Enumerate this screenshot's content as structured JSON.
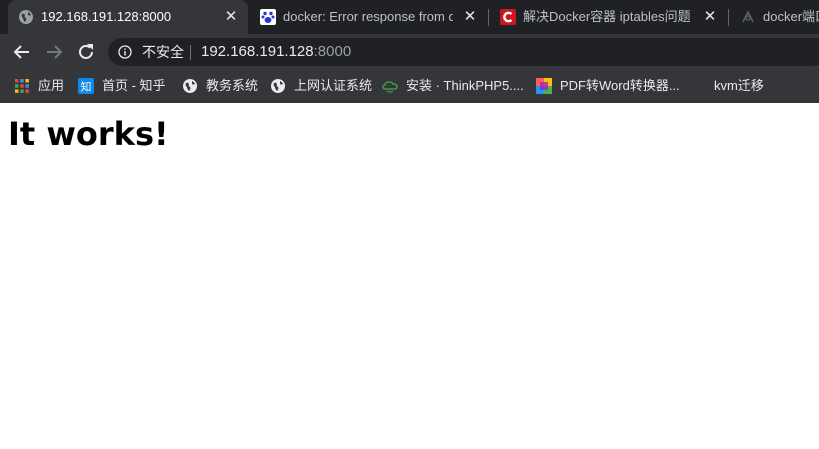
{
  "tabs": [
    {
      "title": "192.168.191.128:8000",
      "favicon": "globe-icon",
      "active": true
    },
    {
      "title": "docker: Error response from da",
      "favicon": "baidu-paw-icon",
      "active": false
    },
    {
      "title": "解决Docker容器 iptables问题---",
      "favicon": "csdn-c-icon",
      "active": false
    },
    {
      "title": "docker端口",
      "favicon": "loading-icon",
      "active": false
    }
  ],
  "tab_close_glyph": "✕",
  "omnibox": {
    "security_label": "不安全",
    "url_host": "192.168.191.128",
    "url_port": ":8000"
  },
  "bookmarks": [
    {
      "label": "应用",
      "icon": "apps-grid-icon"
    },
    {
      "label": "首页 - 知乎",
      "icon": "zhihu-icon"
    },
    {
      "label": "教务系统",
      "icon": "globe-icon"
    },
    {
      "label": "上网认证系统",
      "icon": "globe-icon"
    },
    {
      "label": "安装 · ThinkPHP5....",
      "icon": "thinkphp-cloud-icon"
    },
    {
      "label": "PDF转Word转换器...",
      "icon": "color-blocks-icon"
    },
    {
      "label": "kvm迁移",
      "icon": "blank-page-icon"
    }
  ],
  "page": {
    "heading": "It works!"
  },
  "colors": {
    "chrome_dark": "#202124",
    "chrome_toolbar": "#35363a",
    "text_light": "#e8eaed",
    "csdn_red": "#c9171e",
    "zhihu_blue": "#0f88eb",
    "baidu_blue": "#2932e1"
  }
}
